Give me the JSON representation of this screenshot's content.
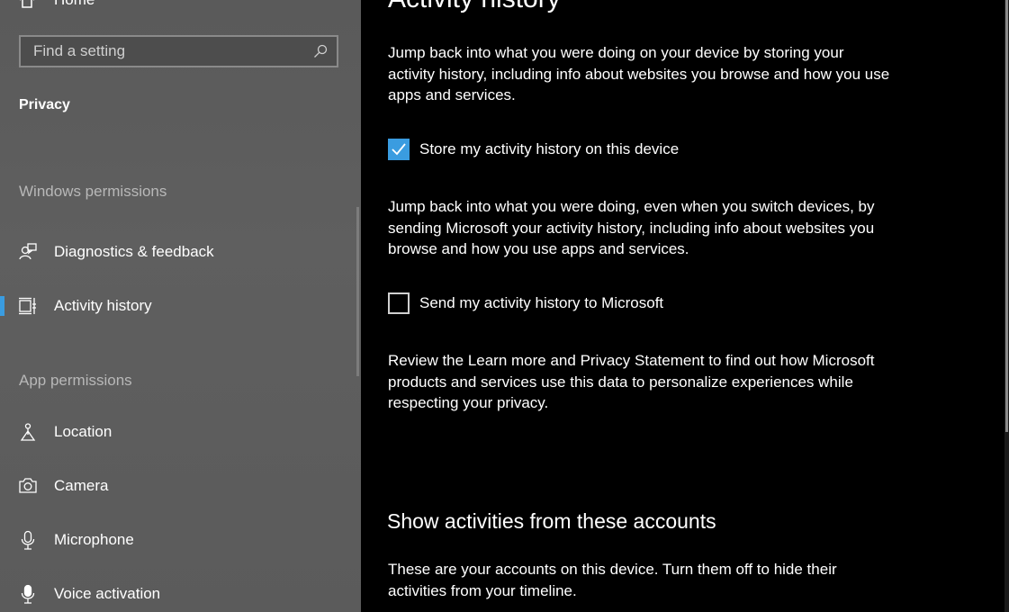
{
  "sidebar": {
    "home_label": "Home",
    "search": {
      "placeholder": "Find a setting"
    },
    "section_title": "Privacy",
    "groups": {
      "windows_permissions": "Windows permissions",
      "app_permissions": "App permissions"
    },
    "items": {
      "diagnostics": "Diagnostics & feedback",
      "activity": "Activity history",
      "location": "Location",
      "camera": "Camera",
      "microphone": "Microphone",
      "voice": "Voice activation"
    },
    "active_item": "Activity history"
  },
  "main": {
    "title": "Activity history",
    "intro": "Jump back into what you were doing on your device by storing your activity history, including info about websites you browse and how you use apps and services.",
    "store_checkbox": {
      "label": "Store my activity history on this device",
      "checked": true
    },
    "sync_text": "Jump back into what you were doing, even when you switch devices, by sending Microsoft your activity history, including info about websites you browse and how you use apps and services.",
    "send_checkbox": {
      "label": "Send my activity history to Microsoft",
      "checked": false
    },
    "review_text": "Review the Learn more and Privacy Statement to find out how Microsoft products and services use this data to personalize experiences while respecting your privacy.",
    "accounts_heading": "Show activities from these accounts",
    "accounts_text": "These are your accounts on this device. Turn them off to hide their activities from your timeline."
  },
  "colors": {
    "accent": "#3a9ce0",
    "sidebar_bg": "#5c5c5c",
    "main_bg": "#000000"
  },
  "icons": [
    "home-icon",
    "search-icon",
    "diagnostics-icon",
    "activity-history-icon",
    "location-icon",
    "camera-icon",
    "microphone-icon",
    "voice-activation-icon",
    "checkmark-icon"
  ]
}
